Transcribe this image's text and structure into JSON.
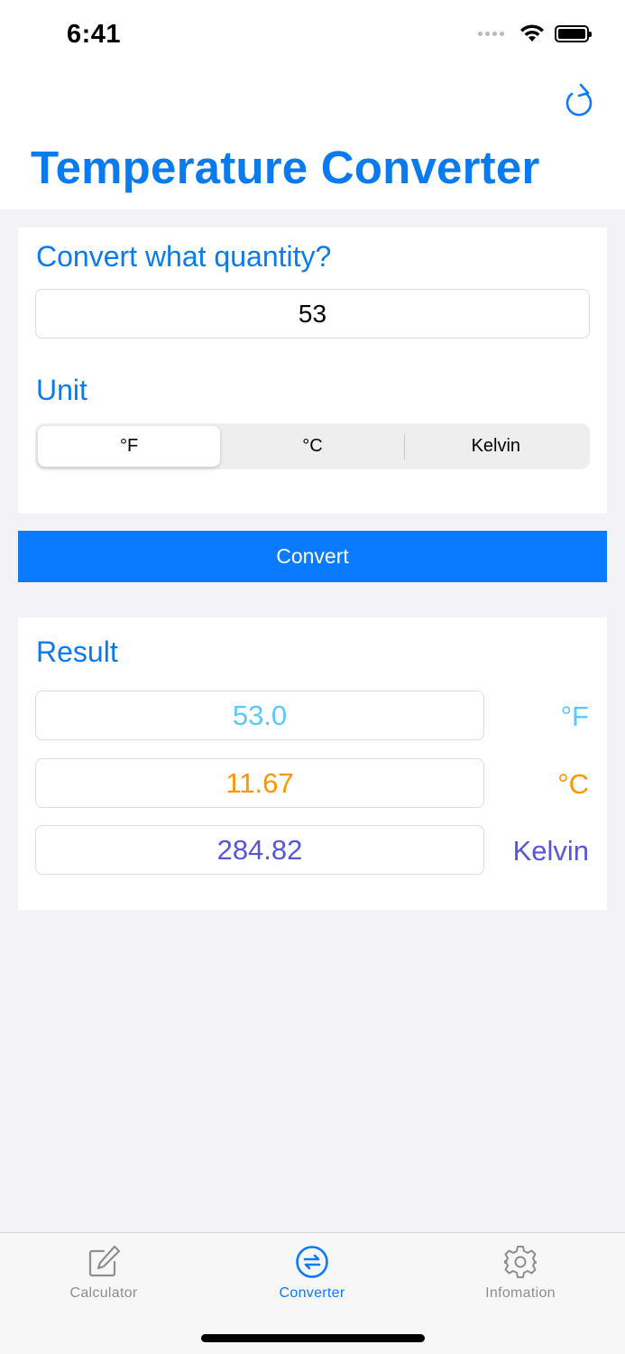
{
  "status_bar": {
    "time": "6:41"
  },
  "header": {
    "title": "Temperature Converter",
    "refresh_icon": "refresh-icon"
  },
  "input_section": {
    "quantity_label": "Convert what quantity?",
    "quantity_value": "53",
    "unit_label": "Unit",
    "units": [
      {
        "label": "°F",
        "selected": true
      },
      {
        "label": "°C",
        "selected": false
      },
      {
        "label": "Kelvin",
        "selected": false
      }
    ]
  },
  "convert_button": {
    "label": "Convert"
  },
  "result_section": {
    "label": "Result",
    "rows": [
      {
        "value": "53.0",
        "unit": "°F",
        "color": "#5ac8fa"
      },
      {
        "value": "11.67",
        "unit": "°C",
        "color": "#ff9500"
      },
      {
        "value": "284.82",
        "unit": "Kelvin",
        "color": "#5856d6"
      }
    ]
  },
  "tab_bar": {
    "tabs": [
      {
        "label": "Calculator",
        "icon": "pencil-square-icon",
        "active": false
      },
      {
        "label": "Converter",
        "icon": "arrows-circle-icon",
        "active": true
      },
      {
        "label": "Infomation",
        "icon": "gear-icon",
        "active": false
      }
    ]
  },
  "colors": {
    "accent": "#0a7aff",
    "title": "#0a7aef",
    "inactive_tab": "#8e8e93"
  }
}
